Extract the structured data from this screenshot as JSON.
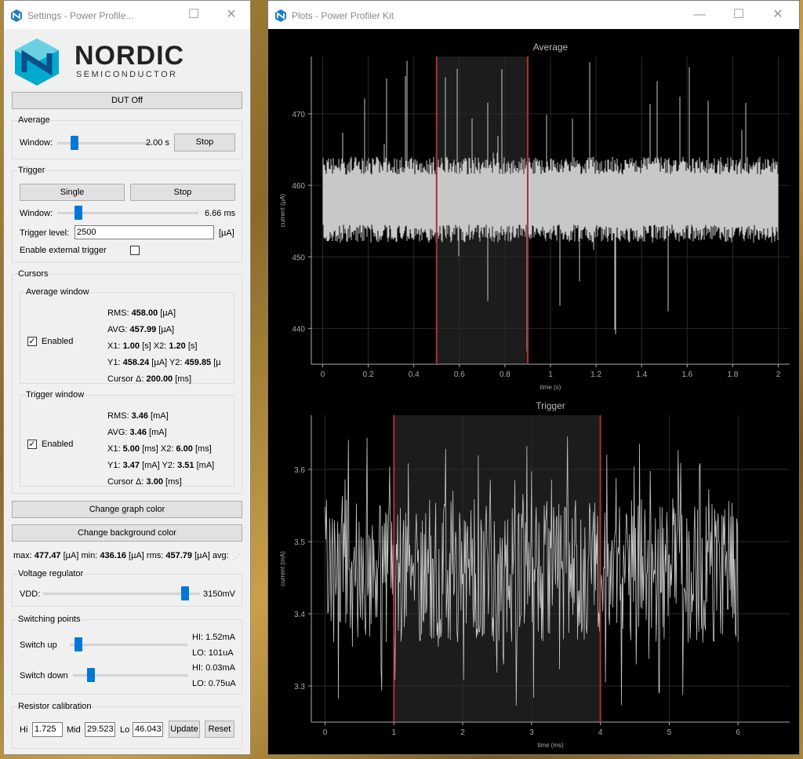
{
  "settings": {
    "title": "Settings - Power Profile...",
    "logo": {
      "brand": "NORDIC",
      "sub": "SEMICONDUCTOR"
    },
    "dut_button": "DUT Off",
    "average": {
      "group": "Average",
      "window_label": "Window:",
      "window_value": "2.00 s",
      "slider_level": 0.06,
      "stop_button": "Stop"
    },
    "trigger": {
      "group": "Trigger",
      "single_button": "Single",
      "stop_button": "Stop",
      "window_label": "Window:",
      "window_value": "6.66 ms",
      "slider_level": 0.07,
      "level_label": "Trigger level:",
      "level_value": "2500",
      "level_unit": "[µA]",
      "external_label": "Enable external trigger",
      "external_checked": false
    },
    "cursors": {
      "group": "Cursors",
      "average_window": {
        "group": "Average window",
        "enabled_label": "Enabled",
        "check": "✓",
        "rms_label": "RMS:",
        "rms_value": "458.00",
        "rms_unit": "[µA]",
        "avg_label": "AVG:",
        "avg_value": "457.99",
        "avg_unit": "[µA]",
        "x1_label": "X1:",
        "x1_value": "1.00",
        "x1_unit": "[s]",
        "x2_label": "X2:",
        "x2_value": "1.20",
        "x2_unit": "[s]",
        "y1_label": "Y1:",
        "y1_value": "458.24",
        "y1_unit": "[µA]",
        "y2_label": "Y2:",
        "y2_value": "459.85",
        "y2_unit": "[µ",
        "delta_label": "Cursor Δ:",
        "delta_value": "200.00",
        "delta_unit": "[ms]"
      },
      "trigger_window": {
        "group": "Trigger window",
        "enabled_label": "Enabled",
        "check": "✓",
        "rms_label": "RMS:",
        "rms_value": "3.46",
        "rms_unit": "[mA]",
        "avg_label": "AVG:",
        "avg_value": "3.46",
        "avg_unit": "[mA]",
        "x1_label": "X1:",
        "x1_value": "5.00",
        "x1_unit": "[ms]",
        "x2_label": "X2:",
        "x2_value": "6.00",
        "x2_unit": "[ms]",
        "y1_label": "Y1:",
        "y1_value": "3.47",
        "y1_unit": "[mA]",
        "y2_label": "Y2:",
        "y2_value": "3.51",
        "y2_unit": "[mA]",
        "delta_label": "Cursor Δ:",
        "delta_value": "3.00",
        "delta_unit": "[ms]"
      }
    },
    "graph_color_button": "Change graph color",
    "background_color_button": "Change background color",
    "stats": {
      "max_label": "max:",
      "max_value": "477.47",
      "max_unit": "[µA]",
      "min_label": "min:",
      "min_value": "436.16",
      "min_unit": "[µA]",
      "rms_label": "rms:",
      "rms_value": "457.79",
      "rms_unit": "[µA]",
      "avg_label": "avg:"
    },
    "voltage": {
      "group": "Voltage regulator",
      "vdd_label": "VDD:",
      "vdd_value": "3150mV",
      "slider_level": 0.72
    },
    "switching": {
      "group": "Switching points",
      "up_label": "Switch up",
      "up_hi": "HI: 1.52mA",
      "up_lo": "LO: 101uA",
      "up_level": 0.03,
      "down_label": "Switch down",
      "down_hi": "HI: 0.03mA",
      "down_lo": "LO: 0.75uA",
      "down_level": 0.1
    },
    "resistor": {
      "group": "Resistor calibration",
      "hi_label": "Hi",
      "hi_value": "1.725",
      "mid_label": "Mid",
      "mid_value": "29.523",
      "lo_label": "Lo",
      "lo_value": "46.043",
      "update_button": "Update",
      "reset_button": "Reset"
    }
  },
  "plots": {
    "title": "Plots - Power Profiler Kit",
    "colors": {
      "background": "#000000",
      "trace": "#c8c8c8",
      "cursor": "#b03030",
      "grid": "#2a2a2a"
    }
  },
  "chart_data": [
    {
      "type": "area",
      "title": "Average",
      "xlabel": "time (s)",
      "ylabel": "current (µA)",
      "xlim": [
        -0.05,
        2.05
      ],
      "ylim": [
        435,
        478
      ],
      "xticks": [
        0,
        0.2,
        0.4,
        0.6,
        0.8,
        1,
        1.2,
        1.4,
        1.6,
        1.8,
        2
      ],
      "xticklabels": [
        "0",
        "0.2",
        "0.4",
        "0.6",
        "0.8",
        "1",
        "1.2",
        "1.4",
        "1.6",
        "1.8",
        "2"
      ],
      "yticks": [
        440,
        450,
        460,
        470
      ],
      "yticklabels": [
        "440",
        "450",
        "460",
        "470"
      ],
      "cursors_x": [
        0.5,
        0.9
      ],
      "series": [
        {
          "band_lower": 454.5,
          "band_upper": 461.5,
          "center": 458,
          "noise_low": 452,
          "noise_high": 464,
          "spike_max": 477.47,
          "spike_min": 436.16
        }
      ],
      "grid": true
    },
    {
      "type": "line",
      "title": "Trigger",
      "xlabel": "time (ms)",
      "ylabel": "current (mA)",
      "xlim": [
        -0.2,
        6.75
      ],
      "ylim": [
        3.25,
        3.675
      ],
      "xticks": [
        0,
        1,
        2,
        3,
        4,
        5,
        6
      ],
      "xticklabels": [
        "0",
        "1",
        "2",
        "3",
        "4",
        "5",
        "6"
      ],
      "yticks": [
        3.3,
        3.4,
        3.5,
        3.6
      ],
      "yticklabels": [
        "3.3",
        "3.4",
        "3.5",
        "3.6"
      ],
      "cursors_x": [
        1.0,
        4.0
      ],
      "series": [
        {
          "center": 3.46,
          "noise_low": 3.36,
          "noise_high": 3.56,
          "peak_high": 3.65,
          "peak_low": 3.27
        }
      ],
      "grid": true
    }
  ]
}
